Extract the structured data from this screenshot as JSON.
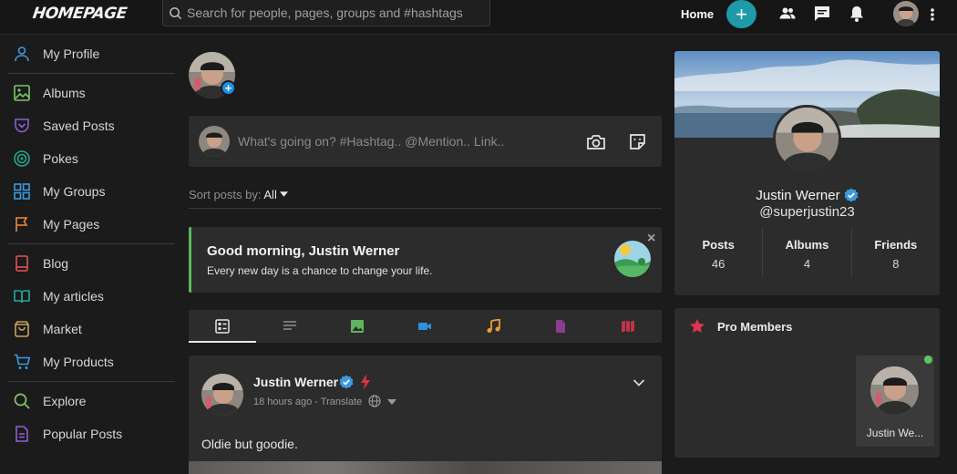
{
  "topbar": {
    "logo": "HOMEPAGE",
    "logo_sub": "",
    "search_placeholder": "Search for people, pages, groups and #hashtags",
    "home_label": "Home",
    "plus_label": "+"
  },
  "sidebar": {
    "groups": [
      [
        {
          "label": "My Profile",
          "icon": "user-icon",
          "color": "#3b9be0"
        }
      ],
      [
        {
          "label": "Albums",
          "icon": "image-icon",
          "color": "#7ec46b"
        },
        {
          "label": "Saved Posts",
          "icon": "bookmark-icon",
          "color": "#8e5fd6"
        },
        {
          "label": "Pokes",
          "icon": "target-icon",
          "color": "#24a88e"
        },
        {
          "label": "My Groups",
          "icon": "grid-icon",
          "color": "#3b9be0"
        },
        {
          "label": "My Pages",
          "icon": "flag-icon",
          "color": "#f08a3a"
        }
      ],
      [
        {
          "label": "Blog",
          "icon": "book-icon",
          "color": "#e2544f"
        },
        {
          "label": "My articles",
          "icon": "open-book-icon",
          "color": "#24a8a0"
        },
        {
          "label": "Market",
          "icon": "bag-icon",
          "color": "#c7a35c"
        },
        {
          "label": "My Products",
          "icon": "cart-icon",
          "color": "#3b9be0"
        }
      ],
      [
        {
          "label": "Explore",
          "icon": "search-icon",
          "color": "#7ec46b"
        },
        {
          "label": "Popular Posts",
          "icon": "document-icon",
          "color": "#8e5fd6"
        }
      ]
    ]
  },
  "composer": {
    "placeholder": "What's going on? #Hashtag.. @Mention.. Link.."
  },
  "sort": {
    "label": "Sort posts by:",
    "value": "All"
  },
  "greeting": {
    "title": "Good morning, Justin Werner",
    "subtitle": "Every new day is a chance to change your life.",
    "close": "×"
  },
  "post": {
    "author": "Justin Werner",
    "meta": "18 hours ago - Translate",
    "text": "Oldie but goodie."
  },
  "profile": {
    "name": "Justin Werner",
    "handle": "@superjustin23",
    "stats": [
      {
        "label": "Posts",
        "value": "46"
      },
      {
        "label": "Albums",
        "value": "4"
      },
      {
        "label": "Friends",
        "value": "8"
      }
    ]
  },
  "pro_members": {
    "title": "Pro Members",
    "member_name": "Justin We..."
  },
  "colors": {
    "accent_teal": "#1e9aa8",
    "verify_blue": "#3b9be0",
    "greeting_border": "#5fb55f"
  }
}
